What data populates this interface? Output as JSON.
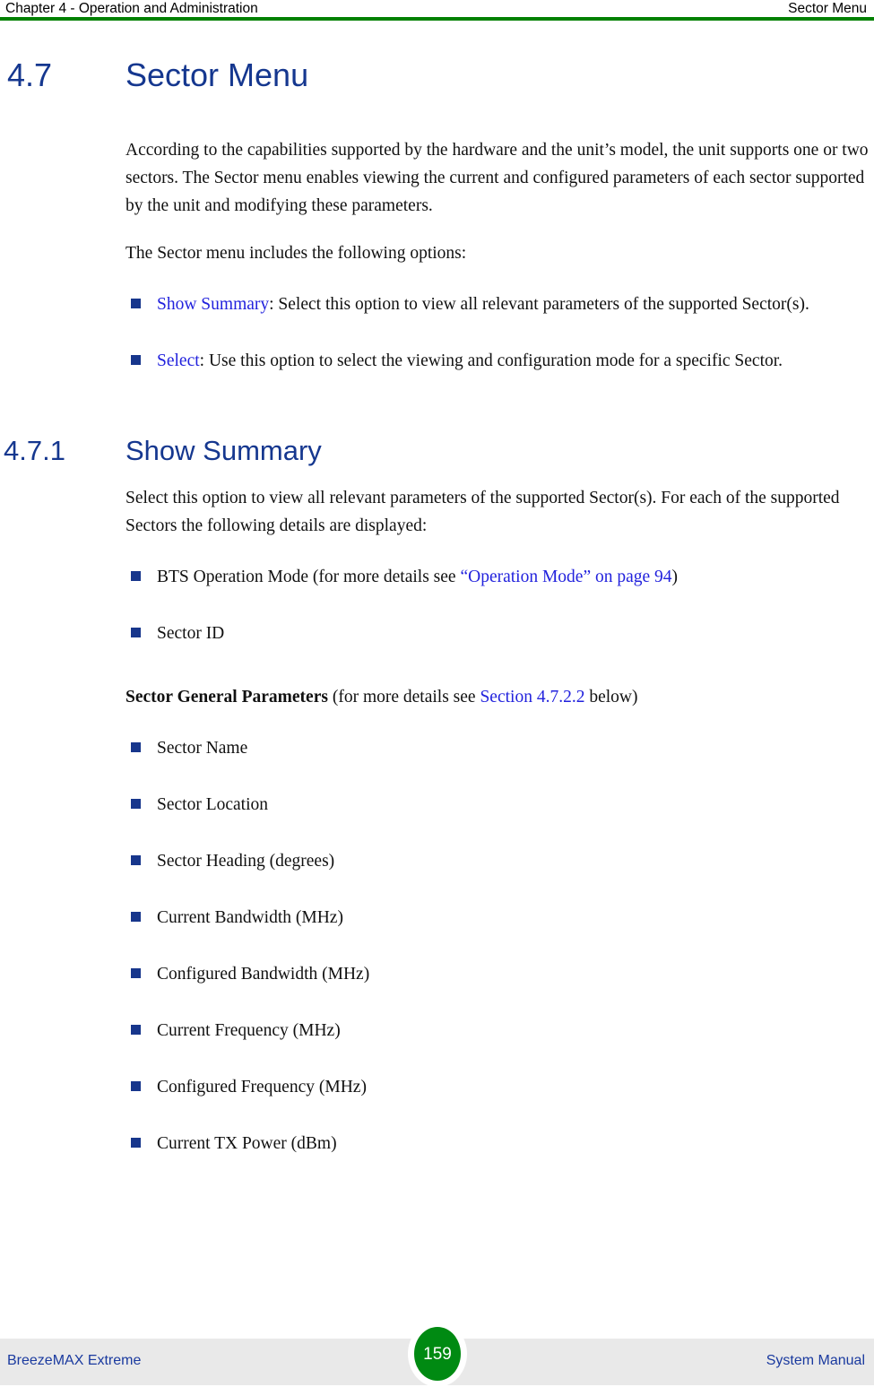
{
  "header": {
    "left": "Chapter 4 - Operation and Administration",
    "right": "Sector Menu",
    "rule_color": "#008000"
  },
  "section": {
    "number": "4.7",
    "title": "Sector Menu",
    "heading_color": "#15378f"
  },
  "intro": {
    "paragraph_1": "According to the capabilities supported by the hardware and the unit’s model, the unit supports one or two sectors. The Sector menu enables viewing the current and configured parameters of each sector supported by the unit and modifying these parameters.",
    "paragraph_2": "The Sector menu includes the following options:"
  },
  "option_bullets": [
    {
      "link": "Show Summary",
      "text": ": Select this option to view all relevant parameters of the supported Sector(s)."
    },
    {
      "link": "Select",
      "text": ": Use this option to select the viewing and configuration mode for a specific Sector."
    }
  ],
  "subsection": {
    "number": "4.7.1",
    "title": "Show Summary",
    "paragraph": "Select this option to view all relevant parameters of the supported Sector(s). For each of the supported Sectors the following details are displayed:"
  },
  "detail_bullets_top": [
    {
      "pre": "BTS Operation Mode (for more details see ",
      "link": "“Operation Mode” on page 94",
      "post": ")"
    },
    {
      "pre": "Sector ID",
      "link": "",
      "post": ""
    }
  ],
  "general_params_lead": {
    "bold": "Sector General Parameters",
    "pre": " (for more details see ",
    "link": "Section 4.7.2.2",
    "post": " below)"
  },
  "detail_bullets_params": [
    "Sector Name",
    "Sector Location",
    "Sector Heading (degrees)",
    "Current Bandwidth (MHz)",
    "Configured Bandwidth (MHz)",
    "Current Frequency (MHz)",
    "Configured Frequency (MHz)",
    "Current TX Power (dBm)"
  ],
  "footer": {
    "left": "BreezeMAX Extreme",
    "right": "System Manual",
    "page_number": "159",
    "badge_color": "#008a12",
    "band_color": "#e9e9e9",
    "text_color": "#1a3a9f"
  },
  "bullet_color": "#17368c",
  "link_color": "#2222dd"
}
